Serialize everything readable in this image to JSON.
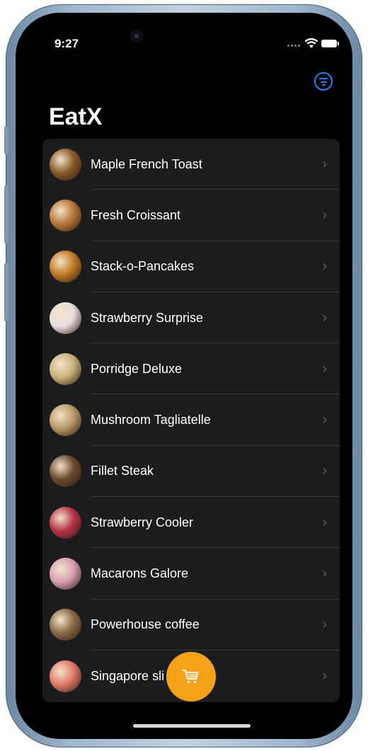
{
  "status_bar": {
    "time": "9:27"
  },
  "header": {
    "title": "EatX",
    "filter_icon": "filter-lines-icon"
  },
  "menu": {
    "items": [
      {
        "label": "Maple French Toast",
        "thumb_color": "#8a5a2b"
      },
      {
        "label": "Fresh Croissant",
        "thumb_color": "#b7783b"
      },
      {
        "label": "Stack-o-Pancakes",
        "thumb_color": "#c07a22"
      },
      {
        "label": "Strawberry Surprise",
        "thumb_color": "#e9dede"
      },
      {
        "label": "Porridge Deluxe",
        "thumb_color": "#c9b27a"
      },
      {
        "label": "Mushroom Tagliatelle",
        "thumb_color": "#b99a6a"
      },
      {
        "label": "Fillet Steak",
        "thumb_color": "#6b4a2e"
      },
      {
        "label": "Strawberry Cooler",
        "thumb_color": "#b8324a"
      },
      {
        "label": "Macarons Galore",
        "thumb_color": "#d9a0b3"
      },
      {
        "label": "Powerhouse coffee",
        "thumb_color": "#8a6a48"
      },
      {
        "label": "Singapore sli",
        "thumb_color": "#e07a6a"
      }
    ],
    "chevron": "chevron-right-icon"
  },
  "cart": {
    "icon": "cart-icon",
    "color": "#f5a11a"
  },
  "colors": {
    "accent": "#2f7df6",
    "list_bg": "#1c1c1e",
    "screen_bg": "#000000"
  }
}
